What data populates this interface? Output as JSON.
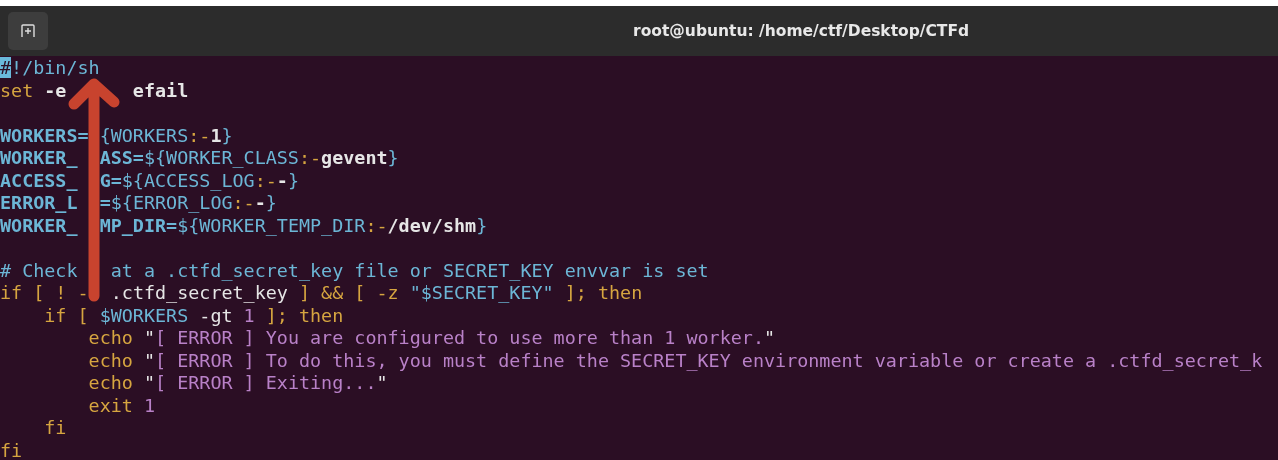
{
  "window": {
    "title": "root@ubuntu: /home/ctf/Desktop/CTFd"
  },
  "lines": [
    {
      "kind": "code",
      "segments": [
        {
          "text": "#",
          "kind": "cursor"
        },
        {
          "text": "!/bin/sh",
          "kind": "comment"
        }
      ]
    },
    {
      "kind": "code",
      "segments": [
        {
          "text": "set",
          "kind": "keyword"
        },
        {
          "text": " -e      efail",
          "kind": "value"
        }
      ]
    },
    {
      "kind": "blank"
    },
    {
      "kind": "code",
      "segments": [
        {
          "text": "WORKERS=",
          "kind": "var"
        },
        {
          "text": " {WORKERS",
          "kind": "comment"
        },
        {
          "text": ":-",
          "kind": "keyword"
        },
        {
          "text": "1",
          "kind": "value"
        },
        {
          "text": "}",
          "kind": "comment"
        }
      ]
    },
    {
      "kind": "code",
      "segments": [
        {
          "text": "WORKER_  ASS=",
          "kind": "var"
        },
        {
          "text": "${WORKER_CLASS",
          "kind": "comment"
        },
        {
          "text": ":-",
          "kind": "keyword"
        },
        {
          "text": "gevent",
          "kind": "value"
        },
        {
          "text": "}",
          "kind": "comment"
        }
      ]
    },
    {
      "kind": "code",
      "segments": [
        {
          "text": "ACCESS_  G=",
          "kind": "var"
        },
        {
          "text": "${ACCESS_LOG",
          "kind": "comment"
        },
        {
          "text": ":-",
          "kind": "keyword"
        },
        {
          "text": "-",
          "kind": "value"
        },
        {
          "text": "}",
          "kind": "comment"
        }
      ]
    },
    {
      "kind": "code",
      "segments": [
        {
          "text": "ERROR_L  =",
          "kind": "var"
        },
        {
          "text": "${ERROR_LOG",
          "kind": "comment"
        },
        {
          "text": ":-",
          "kind": "keyword"
        },
        {
          "text": "-",
          "kind": "value"
        },
        {
          "text": "}",
          "kind": "comment"
        }
      ]
    },
    {
      "kind": "code",
      "segments": [
        {
          "text": "WORKER_  MP_DIR=",
          "kind": "var"
        },
        {
          "text": "${WORKER_TEMP_DIR",
          "kind": "comment"
        },
        {
          "text": ":-",
          "kind": "keyword"
        },
        {
          "text": "/dev/shm",
          "kind": "value"
        },
        {
          "text": "}",
          "kind": "comment"
        }
      ]
    },
    {
      "kind": "blank"
    },
    {
      "kind": "code",
      "segments": [
        {
          "text": "# Check   at a .ctfd_secret_key file or SECRET_KEY envvar is set",
          "kind": "comment"
        }
      ]
    },
    {
      "kind": "code",
      "segments": [
        {
          "text": "if [ ! -  ",
          "kind": "keyword"
        },
        {
          "text": ".ctfd_secret_key",
          "kind": "plain"
        },
        {
          "text": " ] && [ -z ",
          "kind": "keyword"
        },
        {
          "text": "\"$SECRET_KEY\"",
          "kind": "comment"
        },
        {
          "text": " ]; then",
          "kind": "keyword"
        }
      ]
    },
    {
      "kind": "code",
      "segments": [
        {
          "text": "    if [ ",
          "kind": "keyword"
        },
        {
          "text": "$WORKERS",
          "kind": "comment"
        },
        {
          "text": " -gt ",
          "kind": "plain"
        },
        {
          "text": "1",
          "kind": "string"
        },
        {
          "text": " ]; then",
          "kind": "keyword"
        }
      ]
    },
    {
      "kind": "code",
      "segments": [
        {
          "text": "        echo ",
          "kind": "keyword"
        },
        {
          "text": "\"",
          "kind": "plain"
        },
        {
          "text": "[ ERROR ] You are configured to use more than 1 worker.",
          "kind": "string"
        },
        {
          "text": "\"",
          "kind": "plain"
        }
      ]
    },
    {
      "kind": "code",
      "segments": [
        {
          "text": "        echo ",
          "kind": "keyword"
        },
        {
          "text": "\"",
          "kind": "plain"
        },
        {
          "text": "[ ERROR ] To do this, you must define the SECRET_KEY environment variable or create a .ctfd_secret_k",
          "kind": "string"
        }
      ]
    },
    {
      "kind": "code",
      "segments": [
        {
          "text": "        echo ",
          "kind": "keyword"
        },
        {
          "text": "\"",
          "kind": "plain"
        },
        {
          "text": "[ ERROR ] Exiting...",
          "kind": "string"
        },
        {
          "text": "\"",
          "kind": "plain"
        }
      ]
    },
    {
      "kind": "code",
      "segments": [
        {
          "text": "        exit ",
          "kind": "keyword"
        },
        {
          "text": "1",
          "kind": "string"
        }
      ]
    },
    {
      "kind": "code",
      "segments": [
        {
          "text": "    fi",
          "kind": "keyword"
        }
      ]
    },
    {
      "kind": "code",
      "segments": [
        {
          "text": "fi",
          "kind": "keyword"
        }
      ]
    }
  ]
}
